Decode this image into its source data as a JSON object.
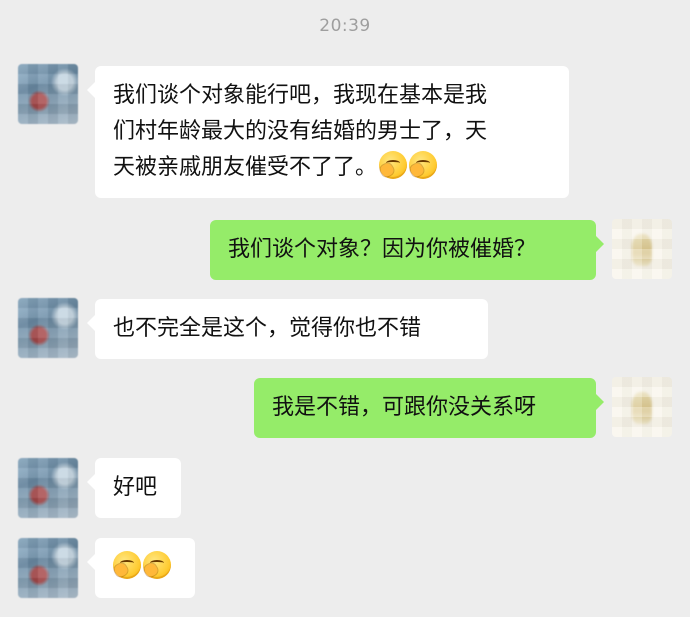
{
  "chat": {
    "timestamp": "20:39",
    "messages": [
      {
        "from": "other",
        "lines": [
          "我们谈个对象能行吧，我现在基本是我",
          "们村年龄最大的没有结婚的男士了，天",
          "天被亲戚朋友催受不了了。"
        ],
        "emojis": [
          "facepalm-emoji",
          "facepalm-emoji"
        ]
      },
      {
        "from": "self",
        "text": "我们谈个对象？因为你被催婚？"
      },
      {
        "from": "other",
        "text": "也不完全是这个，觉得你也不错"
      },
      {
        "from": "self",
        "text": "我是不错，可跟你没关系呀"
      },
      {
        "from": "other",
        "text": "好吧"
      },
      {
        "from": "other",
        "text": "",
        "emojis": [
          "facepalm-emoji",
          "facepalm-emoji"
        ]
      }
    ]
  },
  "colors": {
    "background": "#ededed",
    "self_bubble": "#95ec69",
    "other_bubble": "#ffffff",
    "timestamp": "#9e9e9e"
  }
}
